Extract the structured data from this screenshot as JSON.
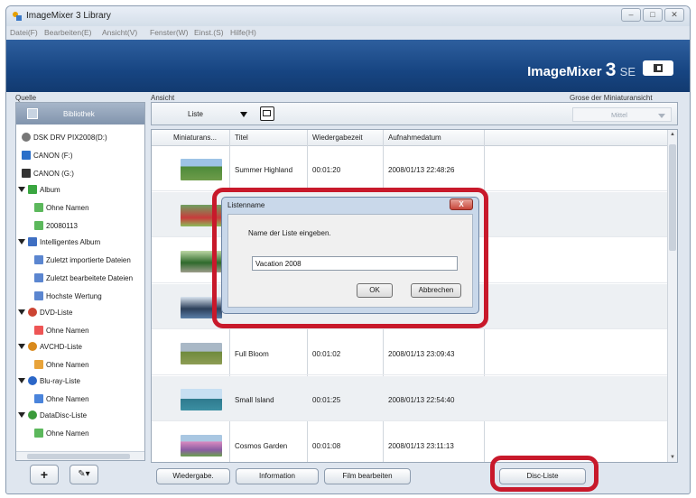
{
  "window": {
    "title": "ImageMixer 3 Library",
    "controls": [
      "–",
      "□",
      "✕"
    ]
  },
  "menu": [
    "Datei(F)",
    "Bearbeiten(E)",
    "Ansicht(V)",
    "Fenster(W)",
    "Einst.(S)",
    "Hilfe(H)"
  ],
  "brand": {
    "name": "ImageMixer",
    "version": "3",
    "edition": "SE"
  },
  "labels": {
    "source": "Quelle",
    "view": "Ansicht",
    "thumb_size": "Grose der Miniaturansicht"
  },
  "library": {
    "header": "Bibliothek"
  },
  "tree": [
    {
      "label": "DSK DRV PIX2008(D:)",
      "icon": "drive-icon"
    },
    {
      "label": "CANON (F:)",
      "icon": "camera-icon"
    },
    {
      "label": "CANON (G:)",
      "icon": "memory-card-icon"
    },
    {
      "label": "Album",
      "icon": "album-icon"
    },
    {
      "label": "Ohne Namen",
      "icon": "album-item-icon"
    },
    {
      "label": "20080113",
      "icon": "album-item-icon"
    },
    {
      "label": "Intelligentes Album",
      "icon": "smart-album-icon"
    },
    {
      "label": "Zuletzt importierte Dateien",
      "icon": "smart-item-icon"
    },
    {
      "label": "Zuletzt bearbeitete Dateien",
      "icon": "smart-item-icon"
    },
    {
      "label": "Hochste Wertung",
      "icon": "smart-item-icon"
    },
    {
      "label": "DVD-Liste",
      "icon": "disc-icon"
    },
    {
      "label": "Ohne Namen",
      "icon": "list-item-icon"
    },
    {
      "label": "AVCHD-Liste",
      "icon": "disc-icon"
    },
    {
      "label": "Ohne Namen",
      "icon": "list-item-icon"
    },
    {
      "label": "Blu-ray-Liste",
      "icon": "disc-icon"
    },
    {
      "label": "Ohne Namen",
      "icon": "list-item-icon"
    },
    {
      "label": "DataDisc-Liste",
      "icon": "disc-icon"
    },
    {
      "label": "Ohne Namen",
      "icon": "list-item-icon"
    }
  ],
  "toolbar": {
    "view_mode": "Liste",
    "thumb_size_value": "Mittel"
  },
  "table": {
    "columns": [
      "Miniaturans...",
      "Titel",
      "Wiedergabezeit",
      "Aufnahmedatum"
    ],
    "rows": [
      {
        "title": "Summer Highland",
        "duration": "00:01:20",
        "date": "2008/01/13 22:48:26"
      },
      {
        "title": "",
        "duration": "",
        "date": ""
      },
      {
        "title": "",
        "duration": "",
        "date": ""
      },
      {
        "title": "",
        "duration": "",
        "date": ""
      },
      {
        "title": "Full Bloom",
        "duration": "00:01:02",
        "date": "2008/01/13 23:09:43"
      },
      {
        "title": "Small Island",
        "duration": "00:01:25",
        "date": "2008/01/13 22:54:40"
      },
      {
        "title": "Cosmos Garden",
        "duration": "00:01:08",
        "date": "2008/01/13 23:11:13"
      }
    ]
  },
  "bottom_buttons": {
    "play": "Wiedergabe.",
    "info": "Information",
    "edit_film": "Film bearbeiten",
    "disc_list": "Disc-Liste"
  },
  "left_tools": {
    "add": "+",
    "wrench": "✎▾"
  },
  "dialog": {
    "title": "Listenname",
    "close": "X",
    "prompt": "Name der Liste eingeben.",
    "input_value": "Vacation 2008",
    "ok": "OK",
    "cancel": "Abbrechen"
  },
  "colors": {
    "banner": "#174582",
    "highlight": "#c8192b",
    "panel_header": "#8194ad"
  }
}
